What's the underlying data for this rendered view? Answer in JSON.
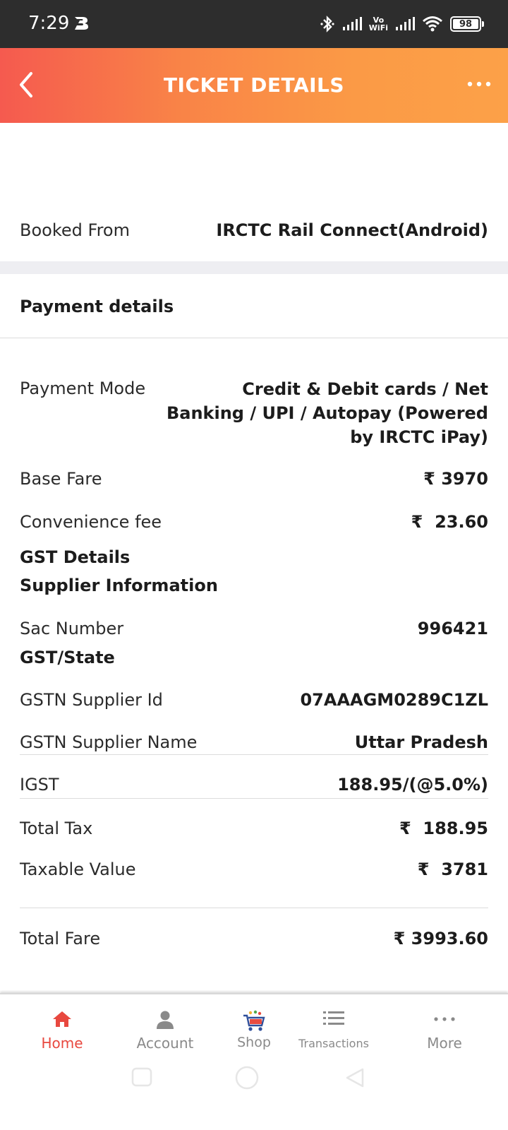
{
  "status_bar": {
    "time": "7:29",
    "network_label_top": "Vo",
    "network_label_bottom": "WiFi",
    "battery": "98"
  },
  "header": {
    "title": "TICKET DETAILS"
  },
  "booked_from": {
    "label": "Booked From",
    "value": "IRCTC Rail Connect(Android)"
  },
  "payment": {
    "heading": "Payment details",
    "mode_label": "Payment Mode",
    "mode_line1": "Credit & Debit cards / Net",
    "mode_line2": "Banking / UPI / Autopay (Powered",
    "mode_line3": "by IRCTC iPay)",
    "base_fare_label": "Base Fare",
    "base_fare_value": "₹ 3970",
    "convenience_label": "Convenience fee",
    "convenience_value": "₹  23.60",
    "gst_details": "GST Details",
    "supplier_info": "Supplier Information",
    "sac_label": "Sac Number",
    "sac_value": "996421",
    "gst_state": "GST/State",
    "gstn_id_label": "GSTN Supplier Id",
    "gstn_id_value": "07AAAGM0289C1ZL",
    "gstn_name_label": "GSTN Supplier Name",
    "gstn_name_value": "Uttar Pradesh",
    "igst_label": "IGST",
    "igst_value": "188.95/(@5.0%)",
    "total_tax_label": "Total Tax",
    "total_tax_value": "₹  188.95",
    "taxable_label": "Taxable Value",
    "taxable_value": "₹  3781",
    "total_fare_label": "Total Fare",
    "total_fare_value": "₹ 3993.60"
  },
  "bottom_nav": {
    "items": [
      {
        "label": "Home",
        "icon": "home-icon"
      },
      {
        "label": "Account",
        "icon": "account-icon"
      },
      {
        "label": "Shop",
        "icon": "shop-cart-icon"
      },
      {
        "label": "Transactions",
        "icon": "list-icon"
      },
      {
        "label": "More",
        "icon": "more-dots-icon"
      }
    ]
  },
  "colors": {
    "header_gradient_start": "#f55a4f",
    "header_gradient_end": "#fca148",
    "active_nav": "#e8483f"
  }
}
